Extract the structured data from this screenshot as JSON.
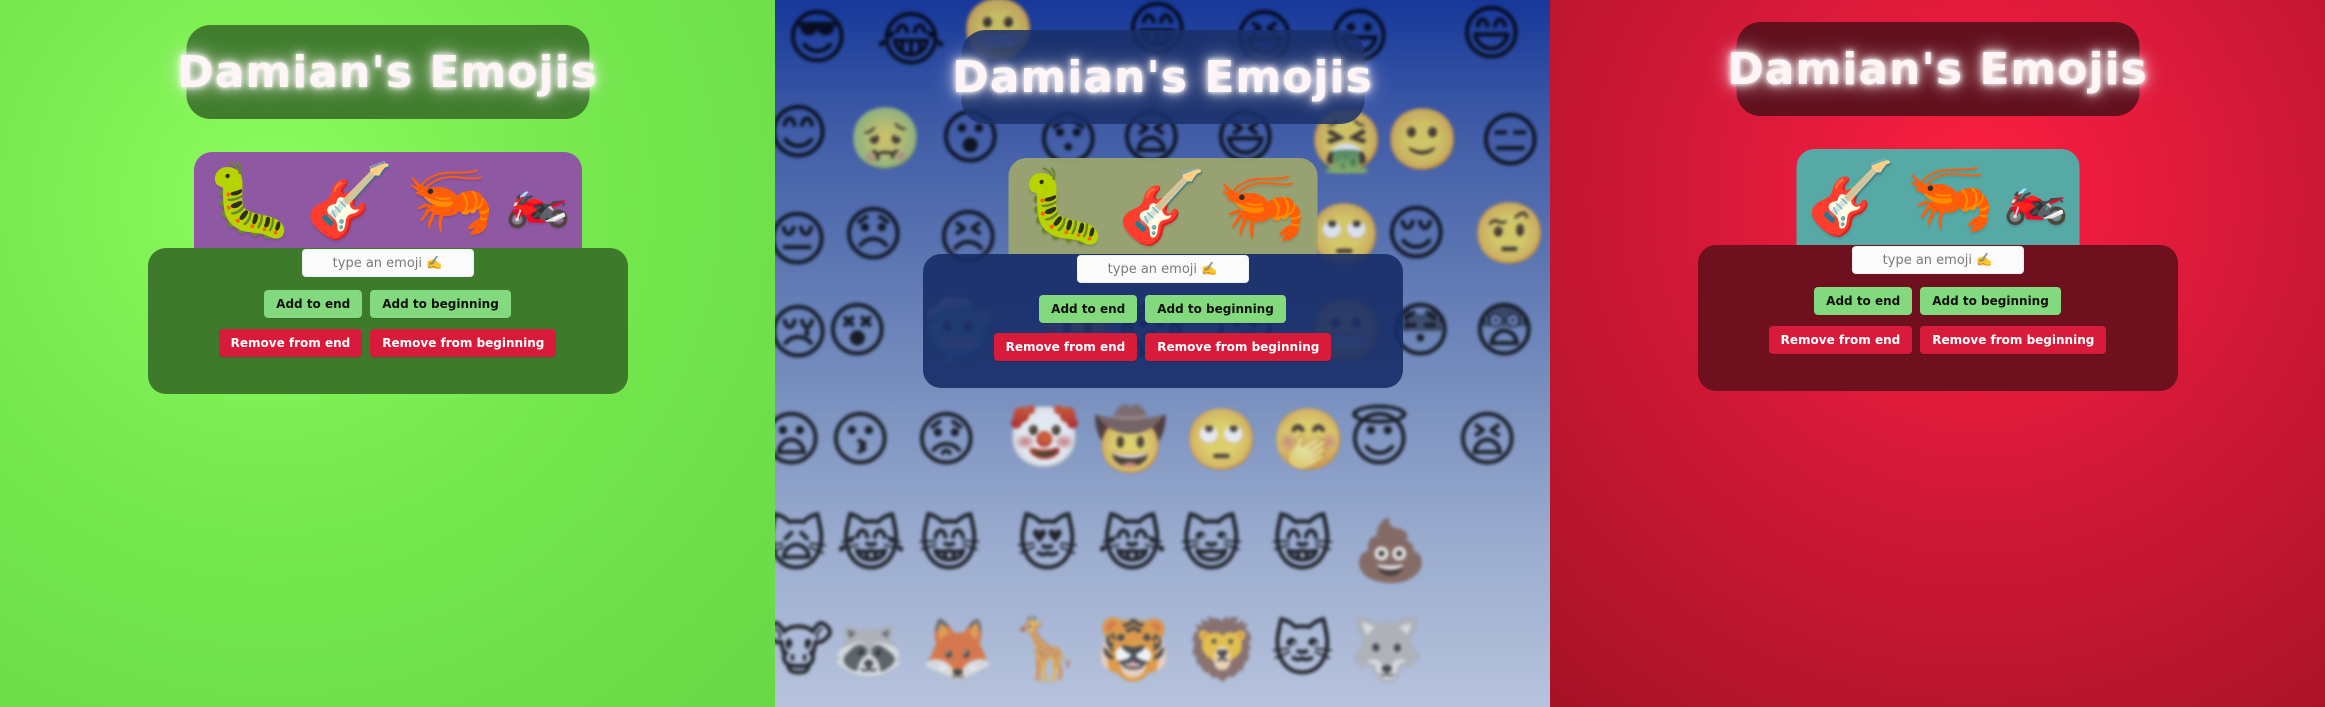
{
  "app": {
    "title": "Damian's Emojis",
    "input_placeholder": "type an emoji ✍️",
    "buttons": {
      "add_end": "Add to end",
      "add_beginning": "Add to beginning",
      "remove_end": "Remove from end",
      "remove_beginning": "Remove from beginning"
    },
    "colors": {
      "green_title_bg": "#407d2d",
      "green_strip_bg": "#8e59a2",
      "green_box_bg": "#3e7a2c",
      "blue_title_bg": "#1a3069",
      "blue_strip_bg": "#9aa36f",
      "blue_box_bg": "#172c67",
      "red_title_bg": "#62101d",
      "red_strip_bg": "#56a9a5",
      "red_box_bg": "#6e101d",
      "add_button": "#83d97d",
      "remove_button": "#d81b3a"
    }
  },
  "panels": [
    {
      "theme": "green",
      "title": "Damian's Emojis",
      "emojis": [
        "🐛",
        "🎸",
        "🦐",
        "🏍️"
      ],
      "emoji_names": [
        "caterpillar-icon",
        "guitar-icon",
        "shrimp-icon",
        "motorcycle-icon"
      ]
    },
    {
      "theme": "blue",
      "title": "Damian's Emojis",
      "emojis": [
        "🐛",
        "🎸",
        "🦐"
      ],
      "emoji_names": [
        "caterpillar-icon",
        "guitar-icon",
        "shrimp-icon"
      ],
      "background_emojis": [
        "😎",
        "😂",
        "😬",
        "😁",
        "😆",
        "😃",
        "😄",
        "😊",
        "🤢",
        "😮",
        "😯",
        "😫",
        "😆",
        "🤮",
        "🙂",
        "😑",
        "😔",
        "😞",
        "😣",
        "🙄",
        "😌",
        "🤨",
        "😢",
        "😵",
        "🥶",
        "🤬",
        "😱",
        "😡",
        "😬",
        "😳",
        "😨",
        "😦",
        "😗",
        "😟",
        "🤡",
        "🤠",
        "🙄",
        "🤭",
        "😇",
        "😫",
        "🙀",
        "😹",
        "😸",
        "😻",
        "😹",
        "😺",
        "😸",
        "💩",
        "🐮",
        "🦝",
        "🦊",
        "🦒",
        "🐯",
        "🦁",
        "🐱",
        "🐺"
      ]
    },
    {
      "theme": "red",
      "title": "Damian's Emojis",
      "emojis": [
        "🎸",
        "🦐",
        "🏍️"
      ],
      "emoji_names": [
        "guitar-icon",
        "shrimp-icon",
        "motorcycle-icon"
      ]
    }
  ]
}
